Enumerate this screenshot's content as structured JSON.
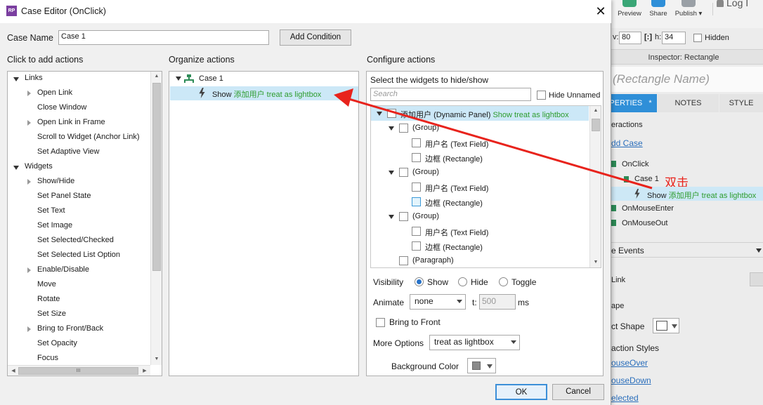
{
  "bg": {
    "toolbar": {
      "preview": "Preview",
      "share": "Share",
      "publish": "Publish ▾",
      "login": "Log I"
    },
    "size_row": {
      "w_label": "v:",
      "w_value": "80",
      "h_label": "h:",
      "h_value": "34",
      "hidden_label": "Hidden"
    },
    "inspector_title": "Inspector: Rectangle",
    "name_placeholder": "(Rectangle Name)",
    "tabs": {
      "properties": "PERTIES",
      "properties_star": "*",
      "notes": "NOTES",
      "style": "STYLE"
    },
    "interactions_label": "eractions",
    "add_case": "dd Case",
    "on_click": "OnClick",
    "case_1": "Case 1",
    "annotation": "双击",
    "show_action": {
      "verb": "Show",
      "target": "添加用户",
      "detail": "treat as lightbox"
    },
    "on_mouse_enter": "OnMouseEnter",
    "on_mouse_out": "OnMouseOut",
    "more_events": "e Events",
    "link_label": "Link",
    "shape_label": "ape",
    "select_shape_label": "ct Shape",
    "interaction_styles": "action Styles",
    "mouse_over": "ouseOver",
    "mouse_down": "ouseDown",
    "selected": "elected"
  },
  "dialog": {
    "title": "Case Editor (OnClick)",
    "close_icon": "close-icon",
    "case_name_label": "Case Name",
    "case_name_value": "Case 1",
    "add_condition": "Add Condition",
    "col_add": "Click to add actions",
    "col_organize": "Organize actions",
    "col_configure": "Configure actions",
    "action_tree": [
      {
        "label": "Links",
        "level": 0,
        "expanded": true
      },
      {
        "label": "Open Link",
        "level": 1,
        "expandable": true
      },
      {
        "label": "Close Window",
        "level": 1
      },
      {
        "label": "Open Link in Frame",
        "level": 1,
        "expandable": true
      },
      {
        "label": "Scroll to Widget (Anchor Link)",
        "level": 1
      },
      {
        "label": "Set Adaptive View",
        "level": 1
      },
      {
        "label": "Widgets",
        "level": 0,
        "expanded": true
      },
      {
        "label": "Show/Hide",
        "level": 1,
        "expandable": true
      },
      {
        "label": "Set Panel State",
        "level": 1
      },
      {
        "label": "Set Text",
        "level": 1
      },
      {
        "label": "Set Image",
        "level": 1
      },
      {
        "label": "Set Selected/Checked",
        "level": 1
      },
      {
        "label": "Set Selected List Option",
        "level": 1
      },
      {
        "label": "Enable/Disable",
        "level": 1,
        "expandable": true
      },
      {
        "label": "Move",
        "level": 1
      },
      {
        "label": "Rotate",
        "level": 1
      },
      {
        "label": "Set Size",
        "level": 1
      },
      {
        "label": "Bring to Front/Back",
        "level": 1,
        "expandable": true
      },
      {
        "label": "Set Opacity",
        "level": 1
      },
      {
        "label": "Focus",
        "level": 1
      }
    ],
    "hscroll_grip": "III",
    "organize": {
      "case": "Case 1",
      "action": {
        "verb": "Show",
        "target": "添加用户",
        "detail": "treat as lightbox"
      }
    },
    "configure": {
      "select_label": "Select the widgets to hide/show",
      "search_placeholder": "Search",
      "hide_unnamed": "Hide Unnamed",
      "widgets": [
        {
          "name": "添加用户",
          "type": "(Dynamic Panel)",
          "action": "Show treat as lightbox",
          "level": 0
        },
        {
          "name": "(Group)",
          "type": "",
          "level": 1
        },
        {
          "name": "用户名",
          "type": "(Text Field)",
          "level": 2
        },
        {
          "name": "边框",
          "type": "(Rectangle)",
          "level": 2
        },
        {
          "name": "(Group)",
          "type": "",
          "level": 1
        },
        {
          "name": "用户名",
          "type": "(Text Field)",
          "level": 2
        },
        {
          "name": "边框",
          "type": "(Rectangle)",
          "level": 2
        },
        {
          "name": "(Group)",
          "type": "",
          "level": 1
        },
        {
          "name": "用户名",
          "type": "(Text Field)",
          "level": 2
        },
        {
          "name": "边框",
          "type": "(Rectangle)",
          "level": 2
        },
        {
          "name": "(Paragraph)",
          "type": "",
          "level": 1
        }
      ],
      "visibility_label": "Visibility",
      "visibility_options": [
        "Show",
        "Hide",
        "Toggle"
      ],
      "visibility_selected": "Show",
      "animate_label": "Animate",
      "animate_value": "none",
      "t_label": "t:",
      "t_value": "500",
      "ms_label": "ms",
      "bring_to_front": "Bring to Front",
      "more_options_label": "More Options",
      "more_options_value": "treat as lightbox",
      "bg_color_label": "Background Color"
    },
    "ok": "OK",
    "cancel": "Cancel"
  },
  "colors": {
    "accent_blue": "#2672c8",
    "selection_blue": "#cce8f7",
    "action_green": "#2d9c2d",
    "annotation_red": "#e8231c"
  }
}
